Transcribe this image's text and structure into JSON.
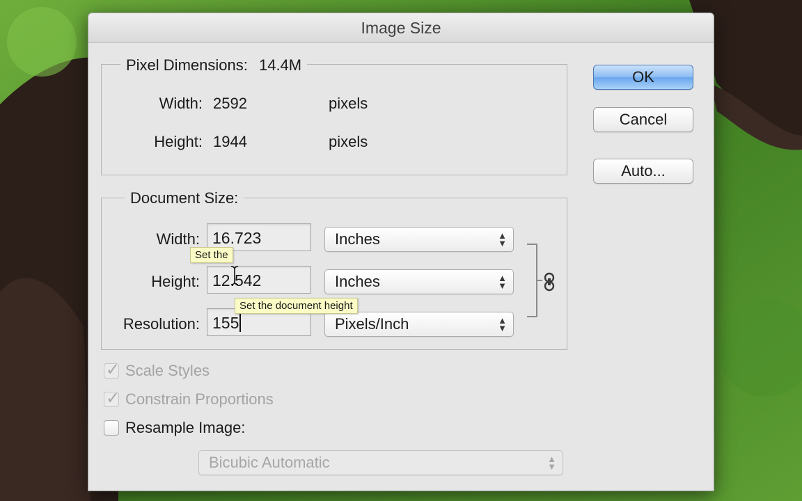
{
  "dialog": {
    "title": "Image Size",
    "pixel_dimensions": {
      "label": "Pixel Dimensions:",
      "size": "14.4M",
      "width_label": "Width:",
      "width_value": "2592",
      "width_unit": "pixels",
      "height_label": "Height:",
      "height_value": "1944",
      "height_unit": "pixels"
    },
    "document_size": {
      "label": "Document Size:",
      "width_label": "Width:",
      "width_value": "16.723",
      "width_unit": "Inches",
      "height_label": "Height:",
      "height_value": "12.542",
      "height_unit": "Inches",
      "resolution_label": "Resolution:",
      "resolution_value": "155",
      "resolution_unit": "Pixels/Inch"
    },
    "options": {
      "scale_styles": "Scale Styles",
      "scale_styles_checked": true,
      "constrain": "Constrain Proportions",
      "constrain_checked": true,
      "resample": "Resample Image:",
      "resample_checked": false,
      "resample_method": "Bicubic Automatic"
    },
    "buttons": {
      "ok": "OK",
      "cancel": "Cancel",
      "auto": "Auto..."
    },
    "tooltips": {
      "partial": "Set the",
      "height": "Set the document height"
    },
    "icons": {
      "link": "chain-link-icon",
      "cursor": "i-beam-cursor-icon",
      "select_arrows": "up-down-arrows-icon",
      "check": "checkmark-icon"
    }
  },
  "colors": {
    "ok_button": "#6aa7ee",
    "tooltip_bg": "#fbfbc6",
    "dialog_bg": "#e6e6e6"
  }
}
